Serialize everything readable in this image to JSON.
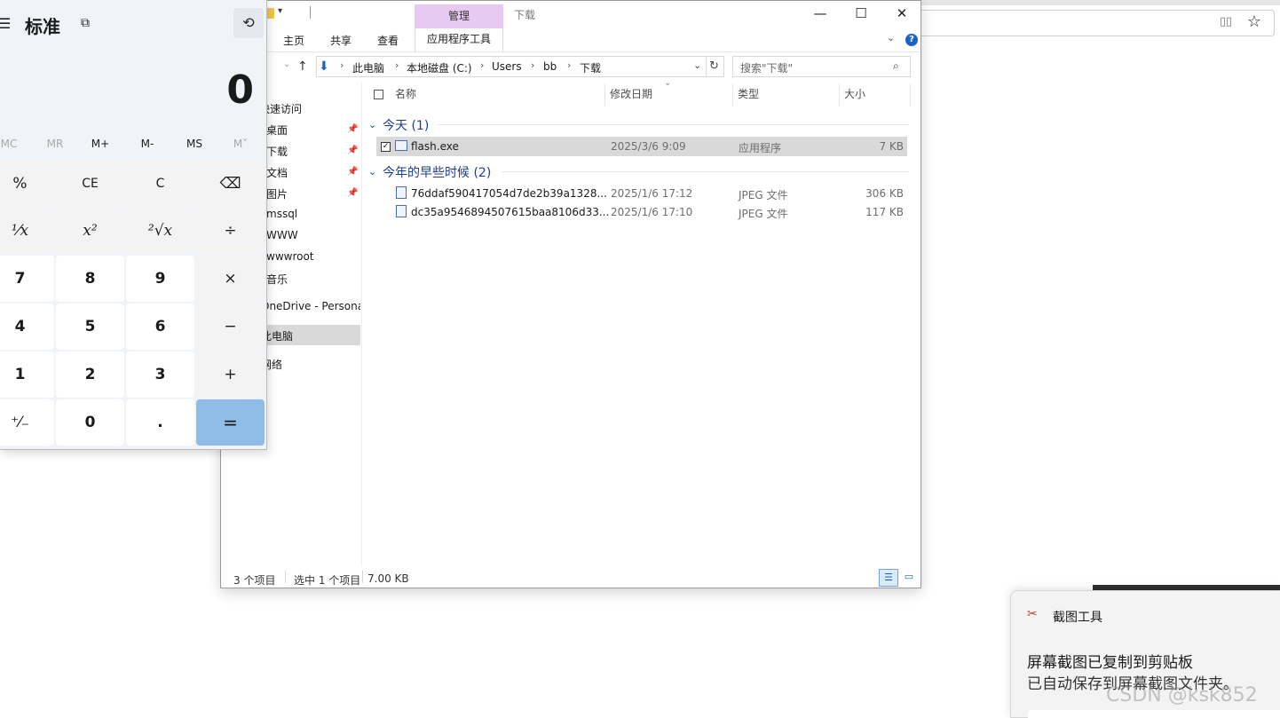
{
  "calculator": {
    "mode_title": "标准",
    "display_value": "0",
    "memory_buttons": [
      {
        "label": "MC",
        "enabled": false
      },
      {
        "label": "MR",
        "enabled": false
      },
      {
        "label": "M+",
        "enabled": true
      },
      {
        "label": "M-",
        "enabled": true
      },
      {
        "label": "MS",
        "enabled": true
      },
      {
        "label": "M˅",
        "enabled": false
      }
    ],
    "keys": [
      [
        "%",
        "CE",
        "C",
        "⌫"
      ],
      [
        "¹⁄x",
        "x²",
        "²√x",
        "÷"
      ],
      [
        "7",
        "8",
        "9",
        "×"
      ],
      [
        "4",
        "5",
        "6",
        "−"
      ],
      [
        "1",
        "2",
        "3",
        "+"
      ],
      [
        "⁺⁄₋",
        "0",
        ".",
        "="
      ]
    ],
    "equals_color": "#8fbde8"
  },
  "explorer": {
    "contextual_tab": "管理",
    "window_title": "下载",
    "contextual_tab_color": "#e8c9f1",
    "ribbon_tabs": [
      "主页",
      "共享",
      "查看",
      "应用程序工具"
    ],
    "breadcrumb": [
      "此电脑",
      "本地磁盘 (C:)",
      "Users",
      "bb",
      "下载"
    ],
    "search_placeholder": "搜索\"下载\"",
    "nav_items": [
      {
        "label": "快速访问",
        "pinned": false
      },
      {
        "label": "桌面",
        "pinned": true
      },
      {
        "label": "下载",
        "pinned": true
      },
      {
        "label": "文档",
        "pinned": true
      },
      {
        "label": "图片",
        "pinned": true
      },
      {
        "label": "mssql",
        "pinned": false
      },
      {
        "label": "WWW",
        "pinned": false
      },
      {
        "label": "wwwroot",
        "pinned": false
      },
      {
        "label": "音乐",
        "pinned": false
      },
      {
        "label": "OneDrive - Persona",
        "pinned": false
      },
      {
        "label": "此电脑",
        "pinned": false,
        "selected": true
      },
      {
        "label": "网络",
        "pinned": false
      }
    ],
    "columns": [
      "名称",
      "修改日期",
      "类型",
      "大小"
    ],
    "groups": [
      {
        "title": "今天 (1)",
        "files": [
          {
            "name": "flash.exe",
            "date": "2025/3/6 9:09",
            "type": "应用程序",
            "size": "7 KB",
            "selected": true
          }
        ]
      },
      {
        "title": "今年的早些时候 (2)",
        "files": [
          {
            "name": "76ddaf590417054d7de2b39a1328...",
            "date": "2025/1/6 17:12",
            "type": "JPEG 文件",
            "size": "306 KB",
            "selected": false
          },
          {
            "name": "dc35a9546894507615baa8106d33...",
            "date": "2025/1/6 17:10",
            "type": "JPEG 文件",
            "size": "117 KB",
            "selected": false
          }
        ]
      }
    ],
    "status": {
      "item_count": "3 个项目",
      "selection": "选中 1 个项目",
      "selection_size": "7.00 KB"
    }
  },
  "toast": {
    "app_name": "截图工具",
    "title": "屏幕截图已复制到剪贴板",
    "body": "已自动保存到屏幕截图文件夹。"
  },
  "watermark": "CSDN @ksk852"
}
